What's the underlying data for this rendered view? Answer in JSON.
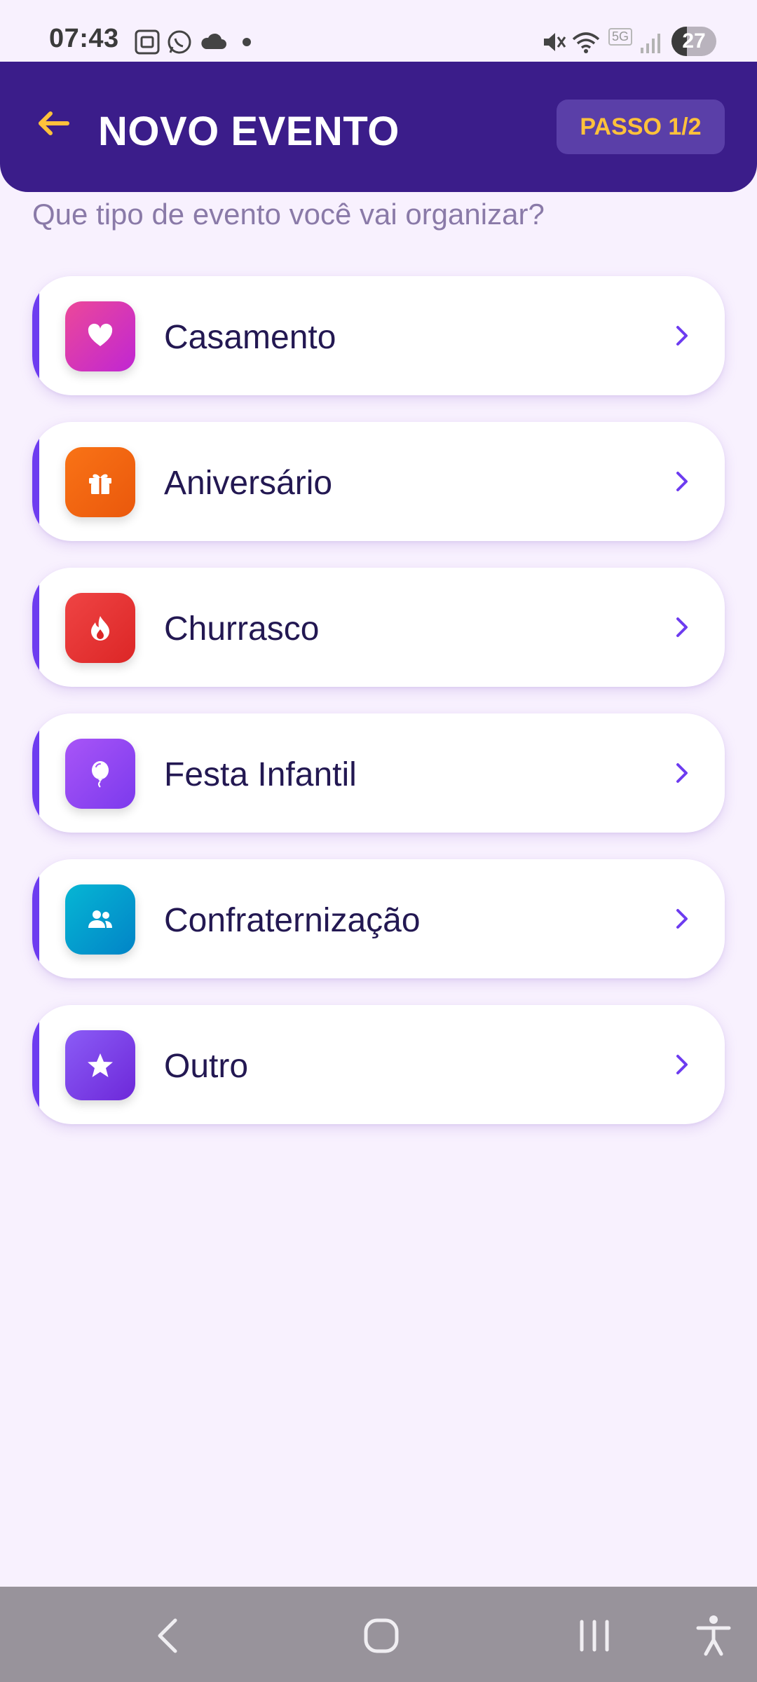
{
  "status_bar": {
    "time": "07:43",
    "battery": "27",
    "network_label": "5G"
  },
  "header": {
    "title": "NOVO EVENTO",
    "step": "PASSO 1/2"
  },
  "question": "Que tipo de evento você vai organizar?",
  "event_types": [
    {
      "label": "Casamento",
      "icon": "heart-icon",
      "color_from": "#ec4899",
      "color_to": "#c026d3"
    },
    {
      "label": "Aniversário",
      "icon": "gift-icon",
      "color_from": "#f97316",
      "color_to": "#ea580c"
    },
    {
      "label": "Churrasco",
      "icon": "flame-icon",
      "color_from": "#ef4444",
      "color_to": "#dc2626"
    },
    {
      "label": "Festa Infantil",
      "icon": "balloon-icon",
      "color_from": "#a855f7",
      "color_to": "#7c3aed"
    },
    {
      "label": "Confraternização",
      "icon": "users-icon",
      "color_from": "#06b6d4",
      "color_to": "#0284c7"
    },
    {
      "label": "Outro",
      "icon": "star-icon",
      "color_from": "#8b5cf6",
      "color_to": "#6d28d9"
    }
  ],
  "colors": {
    "header_bg": "#3b1d8a",
    "accent": "#6d3cf0",
    "step_text": "#ffc13b",
    "back_arrow": "#ffc13b"
  }
}
